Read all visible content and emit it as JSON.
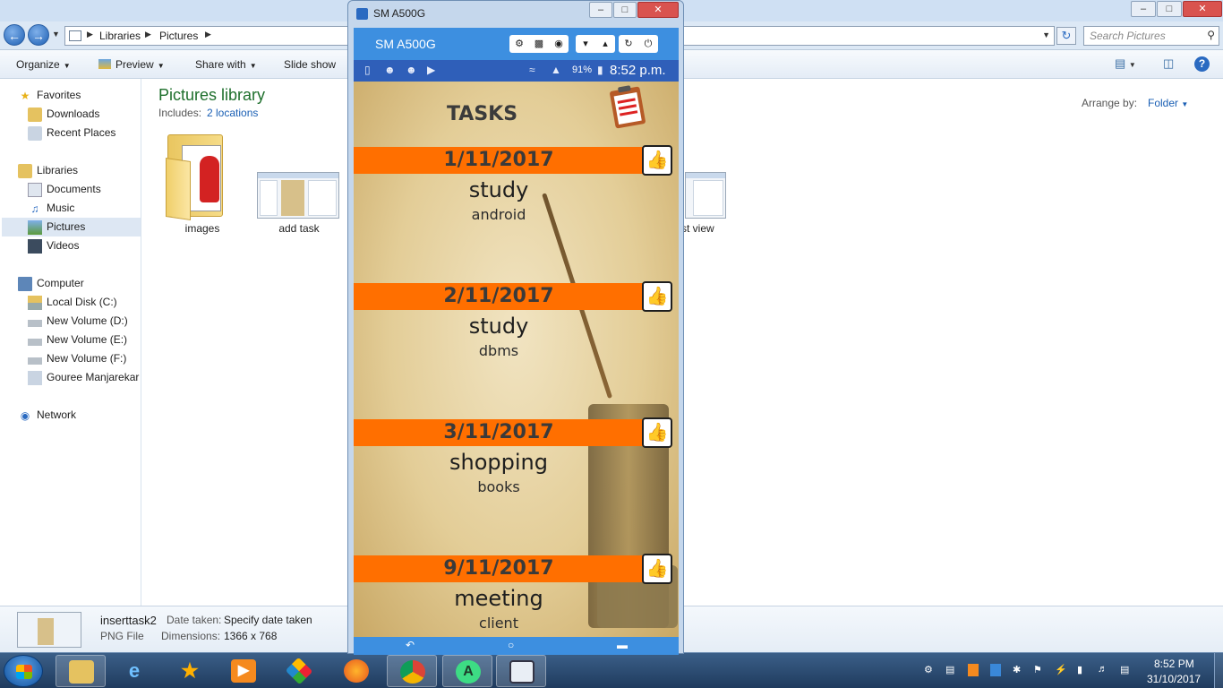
{
  "explorer": {
    "address": {
      "crumbs": [
        "Libraries",
        "Pictures"
      ]
    },
    "search_placeholder": "Search Pictures",
    "toolbar": {
      "organize": "Organize",
      "preview": "Preview",
      "share_with": "Share with",
      "slide_show": "Slide show"
    },
    "nav": {
      "favorites": "Favorites",
      "downloads": "Downloads",
      "recent_places": "Recent Places",
      "libraries": "Libraries",
      "documents": "Documents",
      "music": "Music",
      "pictures": "Pictures",
      "videos": "Videos",
      "computer": "Computer",
      "local_disk": "Local Disk (C:)",
      "vol_d": "New Volume (D:)",
      "vol_e": "New Volume (E:)",
      "vol_f": "New Volume (F:)",
      "gouree": "Gouree Manjarekar (",
      "network": "Network"
    },
    "library": {
      "title": "Pictures library",
      "includes_label": "Includes:",
      "includes_link": "2 locations",
      "arrange_label": "Arrange by:",
      "arrange_value": "Folder"
    },
    "items": [
      {
        "label": "images"
      },
      {
        "label": "add task"
      },
      {
        "label": "st view"
      }
    ],
    "details": {
      "filename": "inserttask2",
      "type": "PNG File",
      "date_label": "Date taken:",
      "date_value": "Specify date taken",
      "dim_label": "Dimensions:",
      "dim_value": "1366 x 768"
    }
  },
  "phone_window": {
    "title": "SM A500G",
    "device_label": "SM A500G",
    "status": {
      "battery": "91%",
      "time": "8:52 p.m."
    },
    "app": {
      "heading": "TASKS",
      "tasks": [
        {
          "date": "1/11/2017",
          "name": "study",
          "detail": "android"
        },
        {
          "date": "2/11/2017",
          "name": "study",
          "detail": "dbms"
        },
        {
          "date": "3/11/2017",
          "name": "shopping",
          "detail": "books"
        },
        {
          "date": "9/11/2017",
          "name": "meeting",
          "detail": "client"
        }
      ]
    }
  },
  "taskbar": {
    "time": "8:52 PM",
    "date": "31/10/2017"
  },
  "colors": {
    "task_band": "#ff6f00",
    "phone_toolbar": "#3d8fe0",
    "status_bar": "#2f5fb9",
    "library_title": "#1e6f2c",
    "link": "#1a5fb4"
  },
  "icons": [
    "back-arrow-icon",
    "forward-arrow-icon",
    "search-icon",
    "refresh-icon",
    "star-icon",
    "folder-icon",
    "music-icon",
    "computer-icon",
    "network-icon",
    "thumbs-up-icon",
    "clipboard-icon",
    "settings-icon",
    "video-icon",
    "camera-icon",
    "volume-down-icon",
    "volume-up-icon",
    "rotate-icon",
    "power-icon"
  ]
}
